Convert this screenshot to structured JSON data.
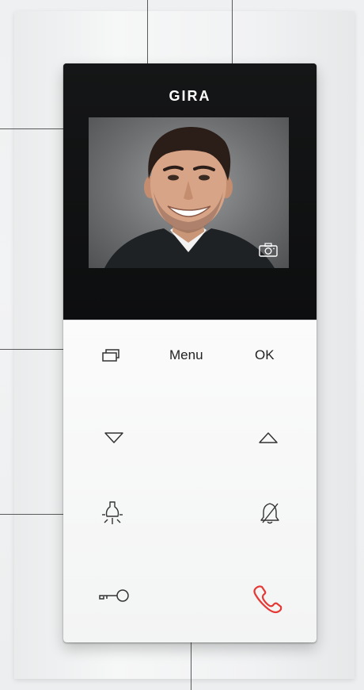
{
  "brand": "GIRA",
  "buttons": {
    "menu_label": "Menu",
    "ok_label": "OK"
  },
  "icons": {
    "screens": "screens-icon",
    "down": "triangle-down-icon",
    "up": "triangle-up-icon",
    "light": "light-bulb-icon",
    "mute": "bell-mute-icon",
    "door": "key-icon",
    "call": "handset-icon",
    "camera": "camera-icon"
  },
  "colors": {
    "call_accent": "#e53935",
    "panel_dark": "#121314",
    "panel_light": "#f7f7f7"
  }
}
